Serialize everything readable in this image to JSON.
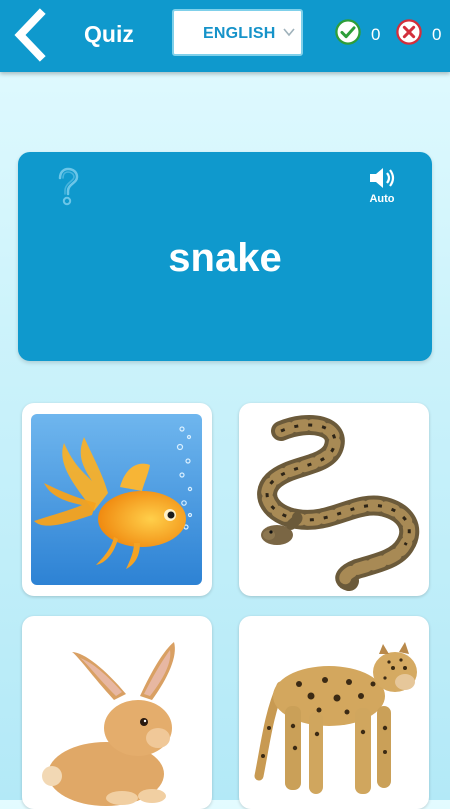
{
  "header": {
    "back_icon": "chevron-left-icon",
    "title": "Quiz",
    "language": {
      "selected": "ENGLISH",
      "caret_icon": "chevron-down-icon"
    },
    "score": {
      "correct": {
        "icon": "check-circle-icon",
        "value": "0"
      },
      "wrong": {
        "icon": "x-circle-icon",
        "value": "0"
      }
    }
  },
  "word_card": {
    "word": "snake",
    "help_icon": "question-mark-icon",
    "audio": {
      "icon": "speaker-icon",
      "label": "Auto"
    }
  },
  "options": [
    {
      "animal": "goldfish"
    },
    {
      "animal": "snake"
    },
    {
      "animal": "rabbit"
    },
    {
      "animal": "leopard"
    }
  ],
  "colors": {
    "primary": "#0f99cd",
    "correct": "#2e9e3a",
    "wrong": "#d32f3c",
    "accent_text": "#1693c9"
  }
}
